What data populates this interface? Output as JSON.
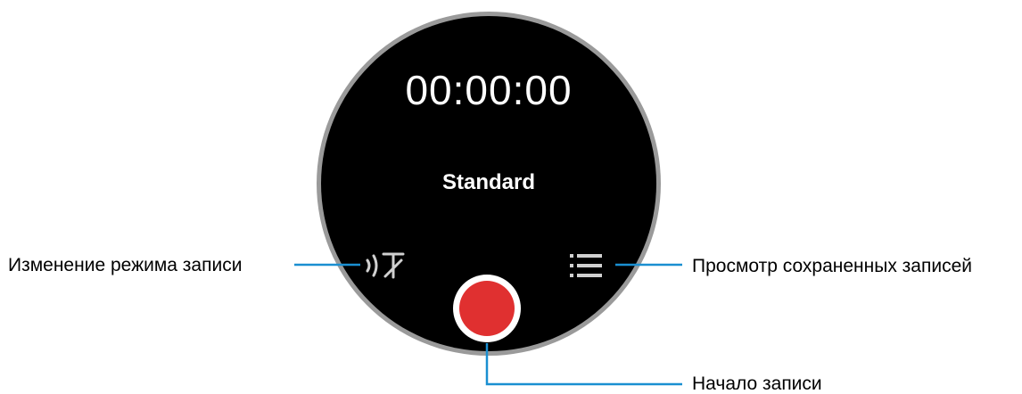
{
  "watch": {
    "timer": "00:00:00",
    "mode": "Standard",
    "mode_icon": "voice-mode-icon",
    "list_icon": "list-icon",
    "record_icon": "record-icon"
  },
  "callouts": {
    "mode_change": "Изменение режима записи",
    "view_saved": "Просмотр сохраненных записей",
    "start_recording": "Начало записи"
  },
  "colors": {
    "record": "#e03030",
    "callout_line": "#1a8fd1",
    "screen": "#000000"
  }
}
